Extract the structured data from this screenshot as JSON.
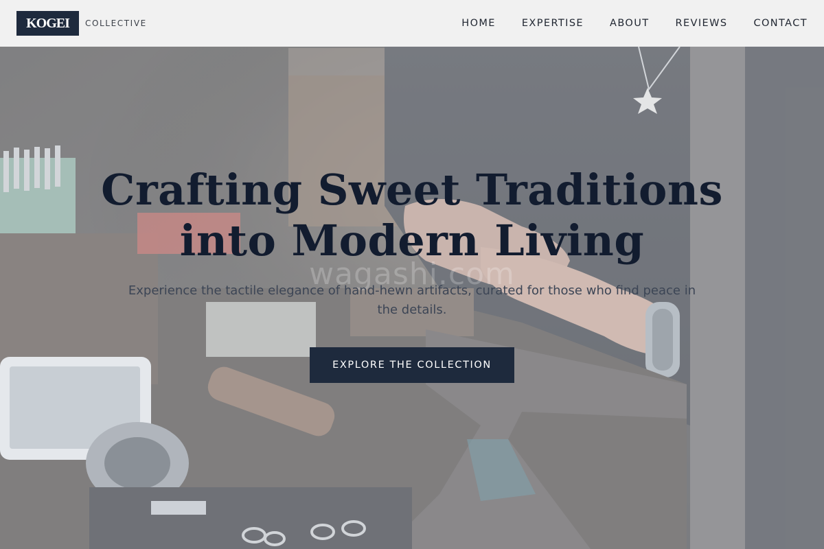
{
  "brand": {
    "logo": "KOGEI",
    "subtitle": "COLLECTIVE",
    "logo_bg": "#1e2a3d"
  },
  "nav": {
    "items": [
      {
        "label": "HOME"
      },
      {
        "label": "EXPERTISE"
      },
      {
        "label": "ABOUT"
      },
      {
        "label": "REVIEWS"
      },
      {
        "label": "CONTACT"
      }
    ]
  },
  "hero": {
    "title_line1": "Crafting Sweet Traditions",
    "title_line2": "into Modern Living",
    "subtitle": "Experience the tactile elegance of hand-hewn artifacts, curated for those who find peace in the details.",
    "watermark": "wagashi.com",
    "cta_label": "EXPLORE THE COLLECTION",
    "background_image": "jewelry-artisan-workbench-photo"
  },
  "colors": {
    "accent": "#1e2a3d",
    "title": "#121c2f",
    "header_bg": "#f6f6f6"
  }
}
